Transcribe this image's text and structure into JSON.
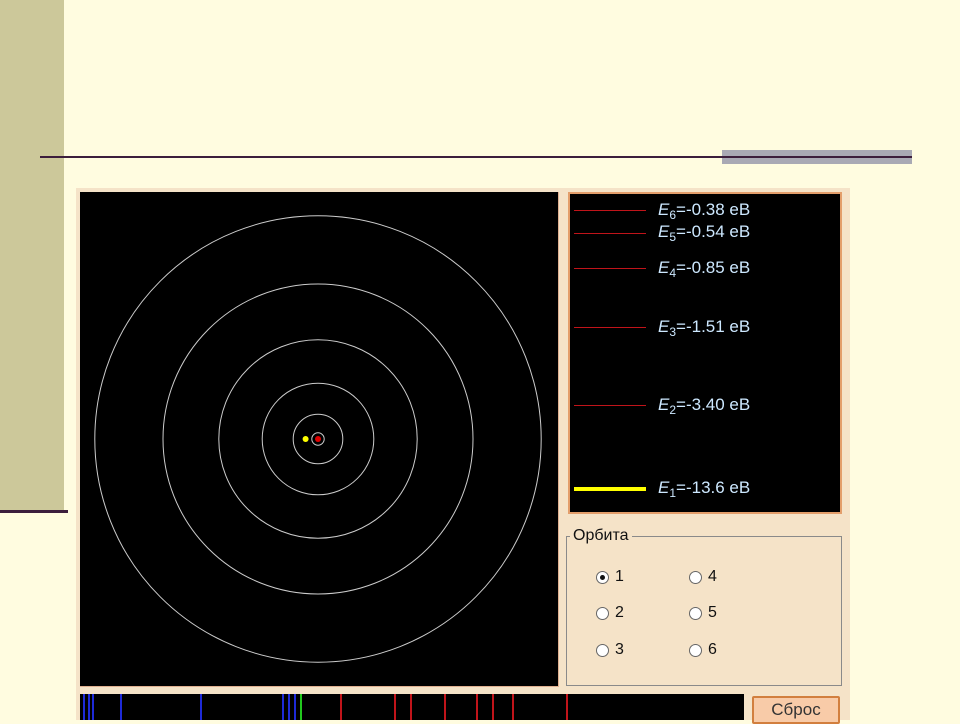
{
  "colors": {
    "slide_background": "#FFFCE0",
    "sidebar": "#CCC89A",
    "rule": "#3C1E3C",
    "applet_background": "#F5E3C8",
    "level_line": "#C0141A",
    "active_level": "#FFFF00",
    "nucleus": "#E00000",
    "electron": "#FFFF00",
    "orbit_stroke": "#CCCCCC",
    "label_text": "#CDE8FF"
  },
  "orbits_count": 6,
  "electron_orbit": 1,
  "energy_levels": [
    {
      "n": "6",
      "value": "=-0.38 eB",
      "active": false
    },
    {
      "n": "5",
      "value": "=-0.54 eB",
      "active": false
    },
    {
      "n": "4",
      "value": "=-0.85 eB",
      "active": false
    },
    {
      "n": "3",
      "value": "=-1.51 eB",
      "active": false
    },
    {
      "n": "2",
      "value": "=-3.40 eB",
      "active": false
    },
    {
      "n": "1",
      "value": "=-13.6 eB",
      "active": true
    }
  ],
  "orbit_selector": {
    "title": "Орбита",
    "options": [
      {
        "label": "1",
        "checked": true
      },
      {
        "label": "2",
        "checked": false
      },
      {
        "label": "3",
        "checked": false
      },
      {
        "label": "4",
        "checked": false
      },
      {
        "label": "5",
        "checked": false
      },
      {
        "label": "6",
        "checked": false
      }
    ]
  },
  "spectrum_lines": [
    {
      "color": "#1E2AD8"
    },
    {
      "color": "#1E2AD8"
    },
    {
      "color": "#1E2AD8"
    },
    {
      "color": "#1E2AD8"
    },
    {
      "color": "#1E2AD8"
    },
    {
      "color": "#1E2AD8"
    },
    {
      "color": "#1E2AD8"
    },
    {
      "color": "#1E2AD8"
    },
    {
      "color": "#22C81E"
    },
    {
      "color": "#C0141A"
    },
    {
      "color": "#C0141A"
    },
    {
      "color": "#C0141A"
    },
    {
      "color": "#C0141A"
    },
    {
      "color": "#C0141A"
    },
    {
      "color": "#C0141A"
    },
    {
      "color": "#C0141A"
    },
    {
      "color": "#C0141A"
    }
  ],
  "reset_label": "Сброс"
}
